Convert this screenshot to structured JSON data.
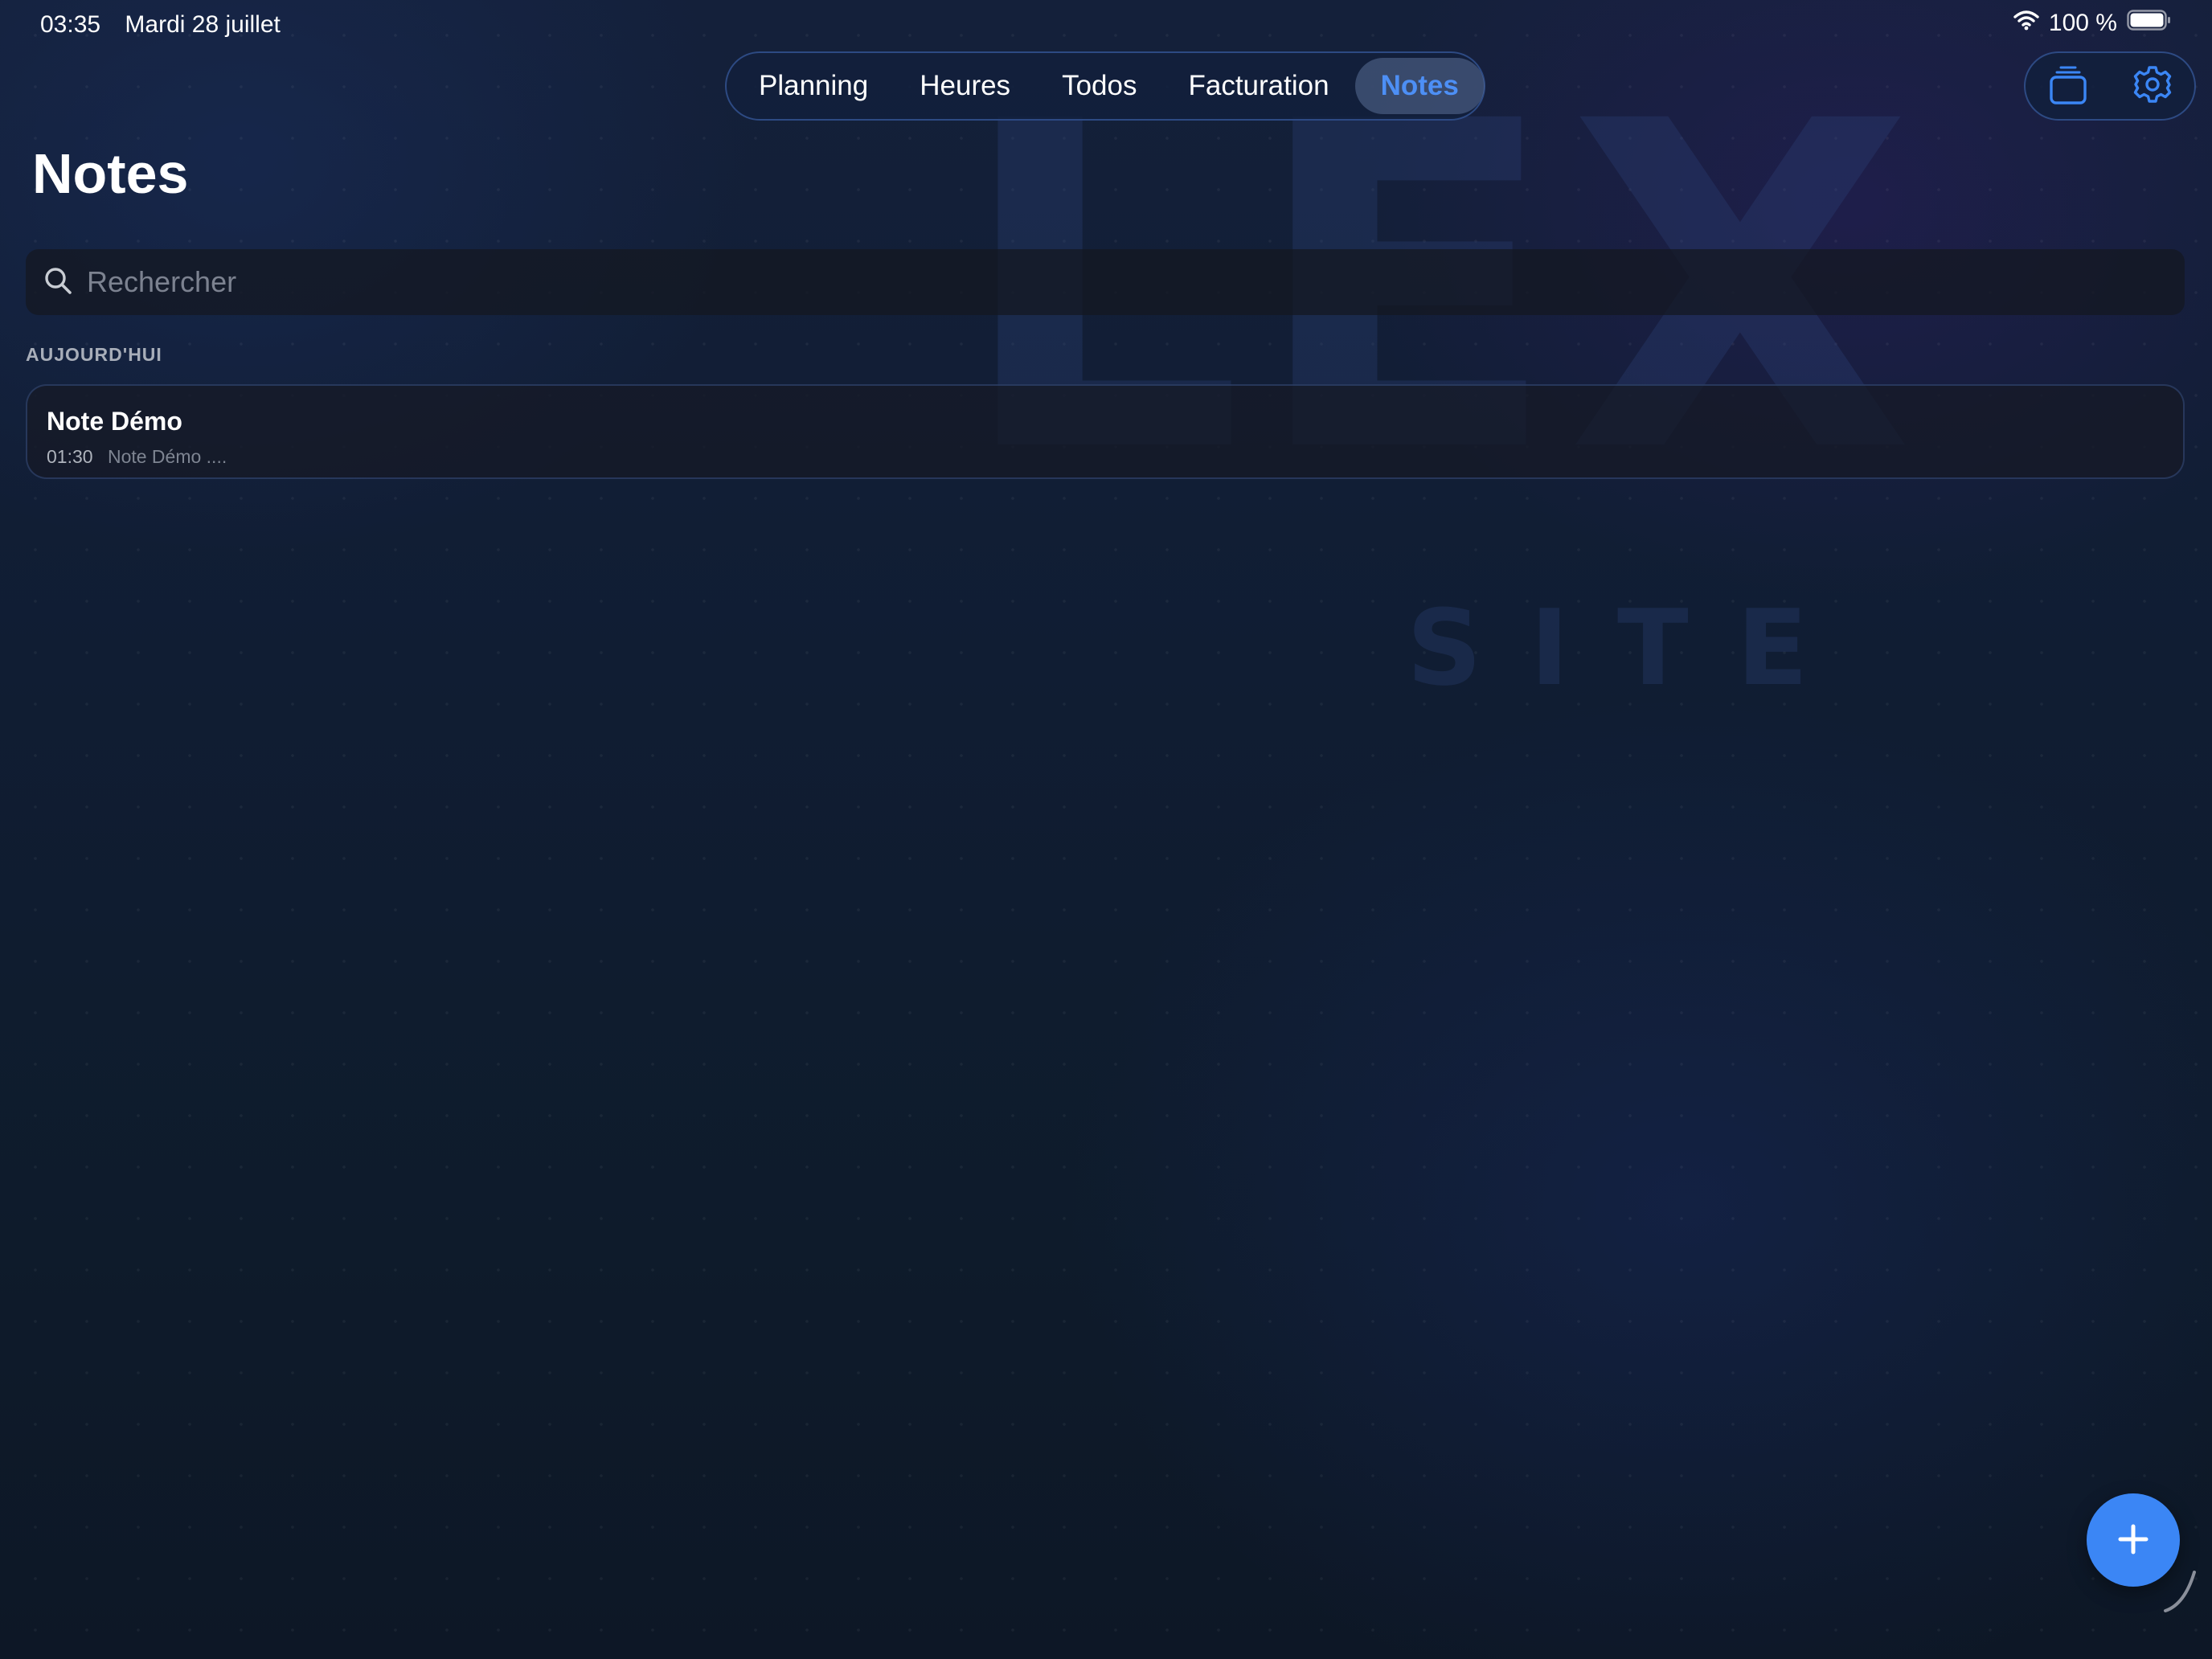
{
  "status_bar": {
    "time": "03:35",
    "date": "Mardi 28 juillet",
    "battery": "100 %"
  },
  "tabs": [
    {
      "label": "Planning",
      "active": false
    },
    {
      "label": "Heures",
      "active": false
    },
    {
      "label": "Todos",
      "active": false
    },
    {
      "label": "Facturation",
      "active": false
    },
    {
      "label": "Notes",
      "active": true
    }
  ],
  "toolbar": {
    "icons": [
      "stack-icon",
      "gear-icon"
    ]
  },
  "page": {
    "title": "Notes"
  },
  "search": {
    "placeholder": "Rechercher",
    "value": ""
  },
  "watermark": {
    "main": "LEX",
    "sub": "SITE"
  },
  "sections": [
    {
      "header": "AUJOURD'HUI",
      "notes": [
        {
          "title": "Note Démo",
          "time": "01:30",
          "preview": "Note Démo ...."
        }
      ]
    }
  ],
  "fab": {
    "icon": "plus-icon"
  },
  "colors": {
    "accent": "#3b86f5",
    "active_tab_text": "#4d8ff5",
    "background": "#101d33",
    "card_border": "#3e5c96"
  }
}
